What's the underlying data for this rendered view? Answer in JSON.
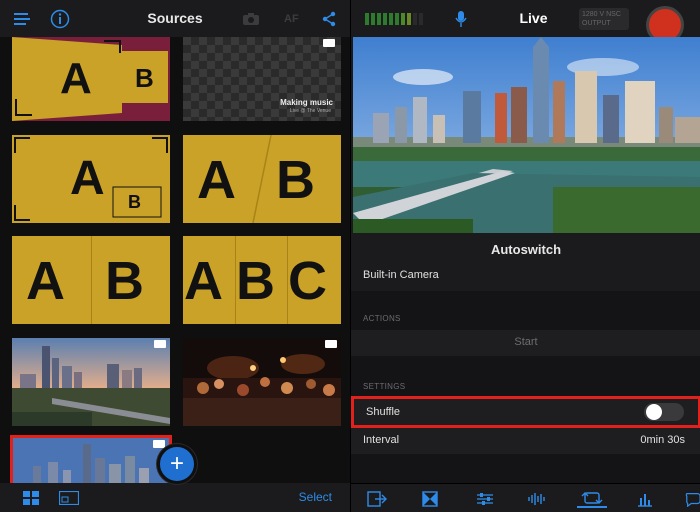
{
  "left_header": {
    "title": "Sources",
    "icons": [
      "menu-icon",
      "info-icon",
      "camera-icon",
      "share-icon"
    ],
    "af_label": "AF"
  },
  "sources": {
    "tiles": [
      {
        "type": "layout",
        "letters": [
          "A",
          "B"
        ],
        "variant": "angled-pip"
      },
      {
        "type": "overlay",
        "caption_title": "Making music",
        "caption_sub": "Live @ The Venue"
      },
      {
        "type": "layout",
        "letters": [
          "A",
          "B"
        ],
        "variant": "pip-corners"
      },
      {
        "type": "layout",
        "letters": [
          "A",
          "B"
        ],
        "variant": "diagonal-split"
      },
      {
        "type": "layout",
        "letters": [
          "A",
          "B"
        ],
        "variant": "side-by-side"
      },
      {
        "type": "layout",
        "letters": [
          "A",
          "B",
          "C"
        ],
        "variant": "three-split"
      },
      {
        "type": "image",
        "subject": "city-skyline"
      },
      {
        "type": "image",
        "subject": "concert-crowd"
      },
      {
        "type": "image",
        "subject": "city-skyline-selected",
        "selected": true
      }
    ]
  },
  "left_toolbar": {
    "add_label": "+",
    "select_label": "Select",
    "icons": [
      "grid-view-icon",
      "layout-view-icon"
    ]
  },
  "right_header": {
    "title": "Live",
    "status_text": "1280 V NSC OUTPUT",
    "icons": [
      "audio-meter-icon",
      "mic-icon",
      "record-button"
    ]
  },
  "autoswitch": {
    "title": "Autoswitch",
    "source_label": "Built-in Camera",
    "actions_section": "ACTIONS",
    "start_label": "Start",
    "settings_section": "SETTINGS",
    "shuffle_label": "Shuffle",
    "shuffle_on": false,
    "interval_label": "Interval",
    "interval_value": "0min 30s"
  },
  "right_toolbar": {
    "icons": [
      "output-icon",
      "transition-icon",
      "mixer-icon",
      "audio-icon",
      "autoswitch-icon",
      "stats-icon",
      "chat-icon"
    ],
    "active": "autoswitch-icon",
    "accent_color": "#2e8ce8"
  },
  "colors": {
    "gold": "#c9a227",
    "accent": "#2e8ce8",
    "record": "#d0311f",
    "highlight": "#e2201c"
  }
}
